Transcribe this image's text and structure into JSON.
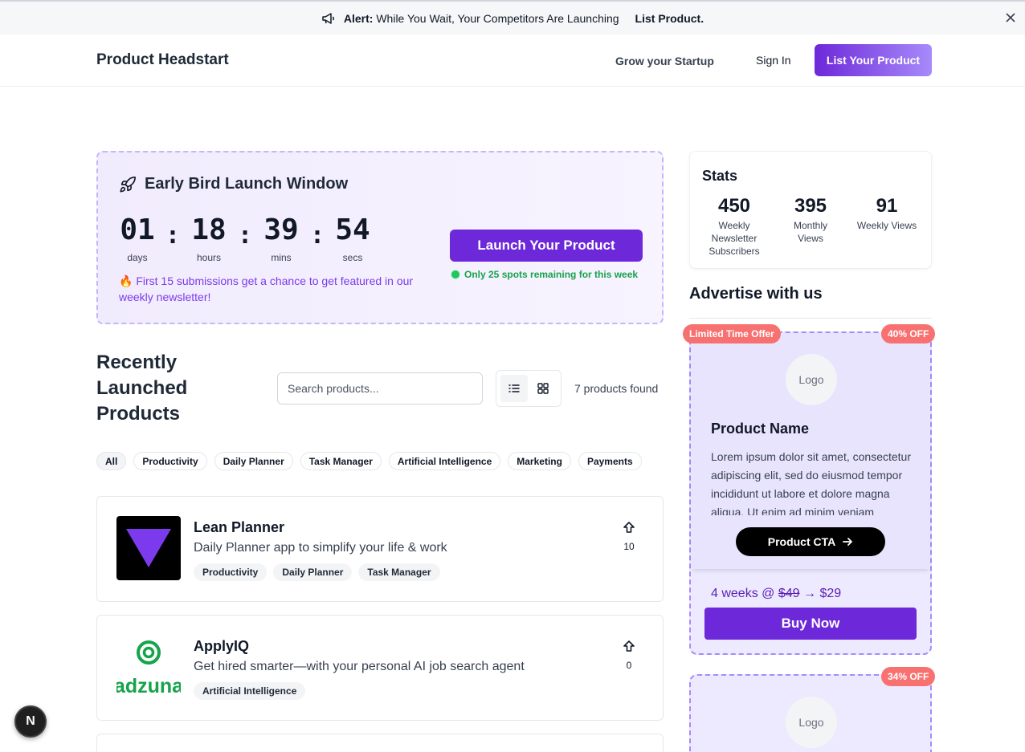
{
  "alert": {
    "label": "Alert:",
    "text": "While You Wait, Your Competitors Are Launching",
    "link": "List Product.",
    "icon": "megaphone-icon",
    "close_icon": "close-icon"
  },
  "nav": {
    "brand": "Product Headstart",
    "grow": "Grow your Startup",
    "signin": "Sign In",
    "list_product": "List Your Product"
  },
  "early_bird": {
    "title": "Early Bird Launch Window",
    "countdown": [
      {
        "value": "01",
        "label": "days"
      },
      {
        "value": "18",
        "label": "hours"
      },
      {
        "value": "39",
        "label": "mins"
      },
      {
        "value": "54",
        "label": "secs"
      }
    ],
    "separator": ":",
    "note": "🔥 First 15 submissions get a chance to get featured in our weekly newsletter!",
    "launch_button": "Launch Your Product",
    "spots": "Only 25 spots remaining for this week"
  },
  "recent": {
    "title": "Recently Launched Products",
    "search_placeholder": "Search products...",
    "found": "7 products found",
    "filters": [
      "All",
      "Productivity",
      "Daily Planner",
      "Task Manager",
      "Artificial Intelligence",
      "Marketing",
      "Payments"
    ],
    "active_filter": "All",
    "products": [
      {
        "name": "Lean Planner",
        "tagline": "Daily Planner app to simplify your life & work",
        "tags": [
          "Productivity",
          "Daily Planner",
          "Task Manager"
        ],
        "upvotes": "10"
      },
      {
        "name": "ApplyIQ",
        "tagline": "Get hired smarter—with your personal AI job search agent",
        "tags": [
          "Artificial Intelligence"
        ],
        "upvotes": "0",
        "logo_text": "adzuna"
      }
    ]
  },
  "stats": {
    "title": "Stats",
    "items": [
      {
        "value": "450",
        "label": "Weekly Newsletter Subscribers"
      },
      {
        "value": "395",
        "label": "Monthly Views"
      },
      {
        "value": "91",
        "label": "Weekly Views"
      }
    ]
  },
  "advertise": {
    "title": "Advertise with us",
    "ads": [
      {
        "badge_left": "Limited Time Offer",
        "badge_right": "40% OFF",
        "logo": "Logo",
        "name": "Product Name",
        "description": "Lorem ipsum dolor sit amet, consectetur adipiscing elit, sed do eiusmod tempor incididunt ut labore et dolore magna aliqua. Ut enim ad minim veniam",
        "cta": "Product CTA",
        "price_prefix": "4 weeks @",
        "price_old": "$49",
        "price_arrow": "→",
        "price_new": "$29",
        "buy": "Buy Now"
      },
      {
        "badge_right": "34% OFF",
        "logo": "Logo"
      }
    ]
  },
  "dev_badge": "N",
  "colors": {
    "primary": "#6d28d9",
    "accent_light": "#a78bfa",
    "success": "#16a34a",
    "badge": "#f87171"
  }
}
